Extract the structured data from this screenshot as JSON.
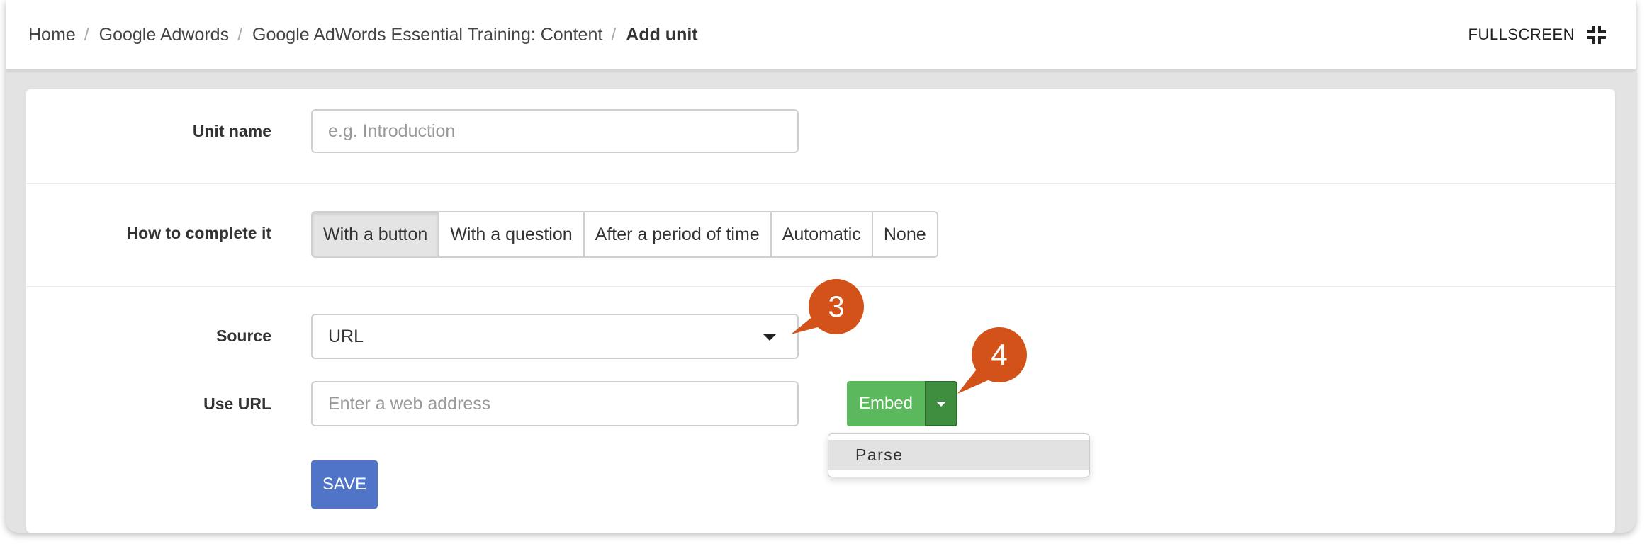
{
  "breadcrumb": {
    "items": [
      "Home",
      "Google Adwords",
      "Google AdWords Essential Training: Content"
    ],
    "current": "Add unit",
    "separator": "/"
  },
  "header": {
    "fullscreen_label": "FULLSCREEN",
    "fullscreen_icon": "exit-fullscreen-icon"
  },
  "form": {
    "unit_name": {
      "label": "Unit name",
      "placeholder": "e.g. Introduction",
      "value": ""
    },
    "completion": {
      "label": "How to complete it",
      "options": [
        "With a button",
        "With a question",
        "After a period of time",
        "Automatic",
        "None"
      ],
      "selected": "With a button"
    },
    "source": {
      "label": "Source",
      "value": "URL"
    },
    "use_url": {
      "label": "Use URL",
      "placeholder": "Enter a web address",
      "value": "",
      "embed_label": "Embed",
      "menu": [
        "Parse"
      ]
    },
    "save_label": "SAVE"
  },
  "callouts": [
    "3",
    "4"
  ],
  "colors": {
    "embed": "#5cb85c",
    "embed_toggle": "#3f8d3f",
    "save": "#4f74c8",
    "callout": "#d2521a"
  }
}
